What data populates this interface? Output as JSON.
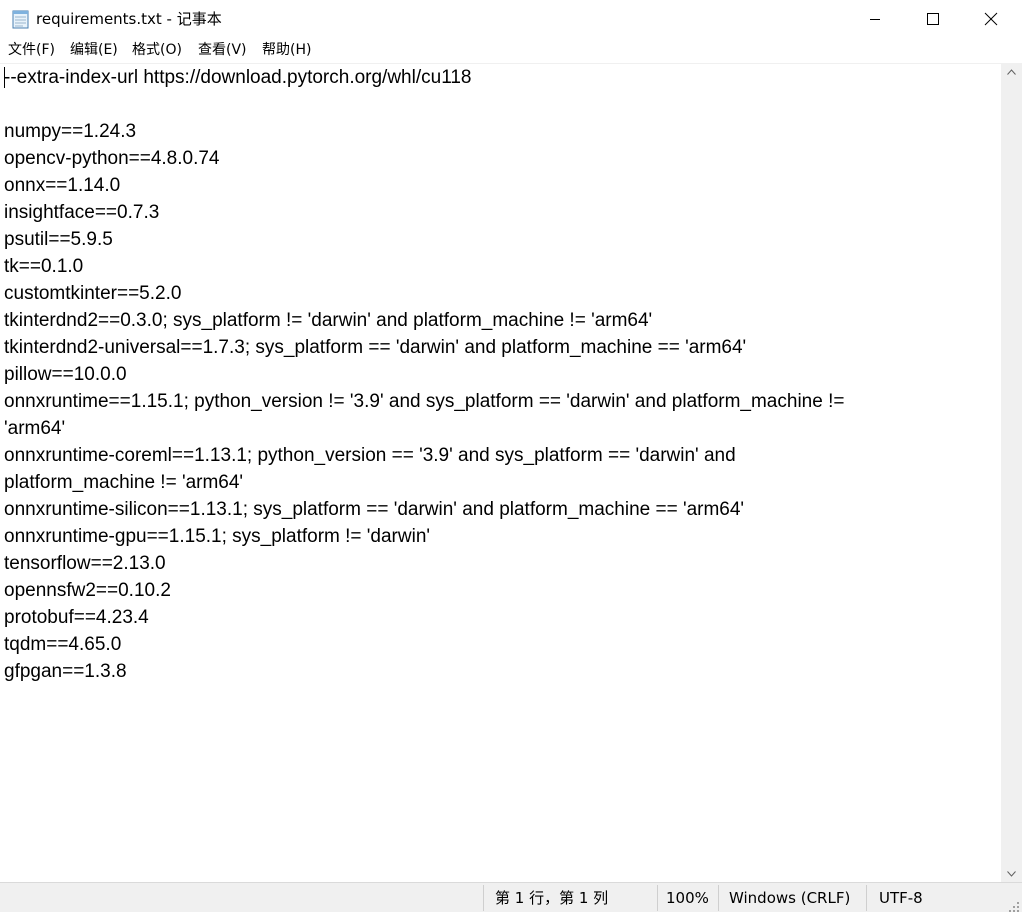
{
  "window": {
    "title": "requirements.txt - 记事本"
  },
  "menu": [
    "文件(F)",
    "编辑(E)",
    "格式(O)",
    "查看(V)",
    "帮助(H)"
  ],
  "editor": {
    "lines": [
      "--extra-index-url https://download.pytorch.org/whl/cu118",
      "",
      "numpy==1.24.3",
      "opencv-python==4.8.0.74",
      "onnx==1.14.0",
      "insightface==0.7.3",
      "psutil==5.9.5",
      "tk==0.1.0",
      "customtkinter==5.2.0",
      "tkinterdnd2==0.3.0; sys_platform != 'darwin' and platform_machine != 'arm64'",
      "tkinterdnd2-universal==1.7.3; sys_platform == 'darwin' and platform_machine == 'arm64'",
      "pillow==10.0.0",
      "onnxruntime==1.15.1; python_version != '3.9' and sys_platform == 'darwin' and platform_machine !=",
      "'arm64'",
      "onnxruntime-coreml==1.13.1; python_version == '3.9' and sys_platform == 'darwin' and",
      "platform_machine != 'arm64'",
      "onnxruntime-silicon==1.13.1; sys_platform == 'darwin' and platform_machine == 'arm64'",
      "onnxruntime-gpu==1.15.1; sys_platform != 'darwin'",
      "tensorflow==2.13.0",
      "opennsfw2==0.10.2",
      "protobuf==4.23.4",
      "tqdm==4.65.0",
      "gfpgan==1.3.8"
    ]
  },
  "status": {
    "position": "第 1 行，第 1 列",
    "zoom": "100%",
    "line_ending": "Windows (CRLF)",
    "encoding": "UTF-8"
  }
}
